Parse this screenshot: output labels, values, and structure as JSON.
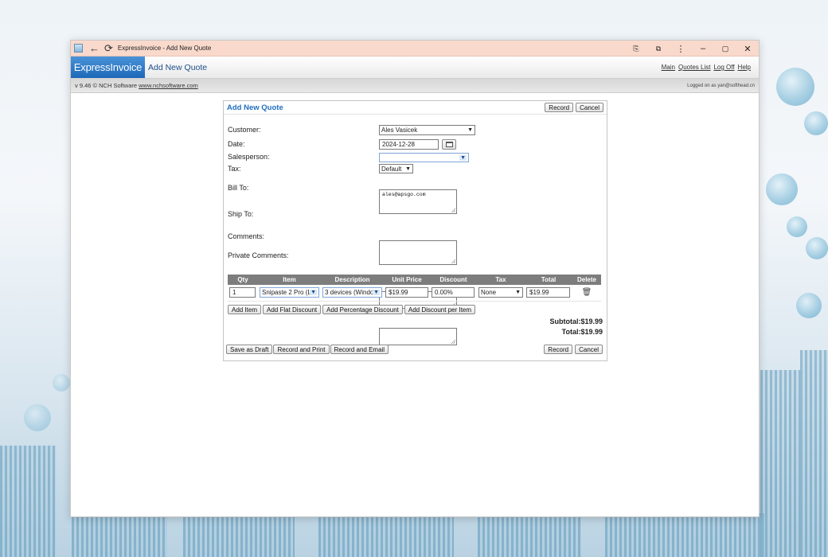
{
  "titlebar": {
    "title": "ExpressInvoice - Add New Quote",
    "back": "←",
    "reload": "⟳",
    "translate": "⎘",
    "extension": "⧉",
    "menu": "⋮",
    "minimize": "–",
    "maximize": "▢",
    "close": "✕"
  },
  "header": {
    "brand": "ExpressInvoice",
    "page_title": "Add New Quote",
    "links": [
      "Main",
      "Quotes List",
      "Log Off",
      "Help"
    ]
  },
  "versionbar": {
    "version": "v 9.46 © NCH Software ",
    "site": "www.nchsoftware.com",
    "logged": "Logged on as yan@softhead.cn"
  },
  "form": {
    "title": "Add New Quote",
    "record": "Record",
    "cancel": "Cancel",
    "labels": {
      "customer": "Customer:",
      "date": "Date:",
      "salesperson": "Salesperson:",
      "tax": "Tax:",
      "bill_to": "Bill To:",
      "ship_to": "Ship To:",
      "comments": "Comments:",
      "private_comments": "Private Comments:"
    },
    "values": {
      "customer": "Ales Vasicek",
      "date": "2024-12-28",
      "salesperson": "",
      "tax": "Default",
      "bill_to": "ales@apsgo.com",
      "ship_to": "",
      "comments": "",
      "private_comments": ""
    }
  },
  "items": {
    "headers": [
      "Qty",
      "Item",
      "Description",
      "Unit Price",
      "Discount",
      "Tax",
      "Total",
      "Delete"
    ],
    "rows": [
      {
        "qty": "1",
        "item": "Snipaste 2 Pro (L",
        "description": "3 devices (Windo",
        "unit_price": "$19.99",
        "discount": "0.00%",
        "tax": "None",
        "total": "$19.99",
        "delete_icon": "trash-icon"
      }
    ],
    "add_buttons": [
      "Add Item",
      "Add Flat Discount",
      "Add Percentage Discount",
      "Add Discount per Item"
    ]
  },
  "totals": {
    "subtotal": "Subtotal:$19.99",
    "total": "Total:$19.99"
  },
  "bottom": {
    "save_draft": "Save as Draft",
    "record_print": "Record and Print",
    "record_email": "Record and Email",
    "record": "Record",
    "cancel": "Cancel"
  }
}
